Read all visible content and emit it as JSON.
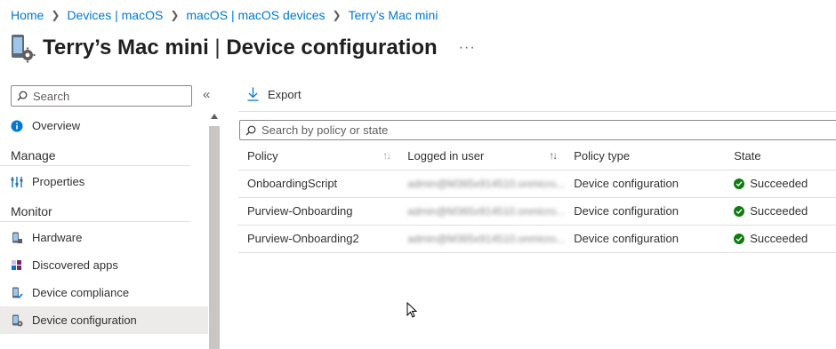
{
  "breadcrumb": [
    {
      "label": "Home"
    },
    {
      "label": "Devices | macOS"
    },
    {
      "label": "macOS | macOS devices"
    },
    {
      "label": "Terry’s Mac mini"
    }
  ],
  "header": {
    "device_name": "Terry’s Mac mini",
    "separator": "|",
    "page_name": "Device configuration",
    "more_label": "···"
  },
  "sidebar": {
    "search_placeholder": "Search",
    "collapse_label": "«",
    "overview_label": "Overview",
    "sections": [
      {
        "title": "Manage",
        "items": [
          {
            "label": "Properties",
            "icon": "properties-icon"
          }
        ]
      },
      {
        "title": "Monitor",
        "items": [
          {
            "label": "Hardware",
            "icon": "hardware-icon"
          },
          {
            "label": "Discovered apps",
            "icon": "discovered-apps-icon"
          },
          {
            "label": "Device compliance",
            "icon": "device-compliance-icon"
          },
          {
            "label": "Device configuration",
            "icon": "device-configuration-icon",
            "active": true
          }
        ]
      }
    ]
  },
  "toolbar": {
    "export_label": "Export"
  },
  "main_search": {
    "placeholder": "Search by policy or state"
  },
  "table": {
    "columns": [
      "Policy",
      "Logged in user",
      "Policy type",
      "State"
    ],
    "rows": [
      {
        "policy": "OnboardingScript",
        "user": "admin@M365x914510.onmicro...",
        "type": "Device configuration",
        "state": "Succeeded"
      },
      {
        "policy": "Purview-Onboarding",
        "user": "admin@M365x914510.onmicro...",
        "type": "Device configuration",
        "state": "Succeeded"
      },
      {
        "policy": "Purview-Onboarding2",
        "user": "admin@M365x914510.onmicro...",
        "type": "Device configuration",
        "state": "Succeeded"
      }
    ]
  },
  "colors": {
    "accent": "#0078d4",
    "success": "#107c10",
    "active_bg": "#edebe9"
  }
}
